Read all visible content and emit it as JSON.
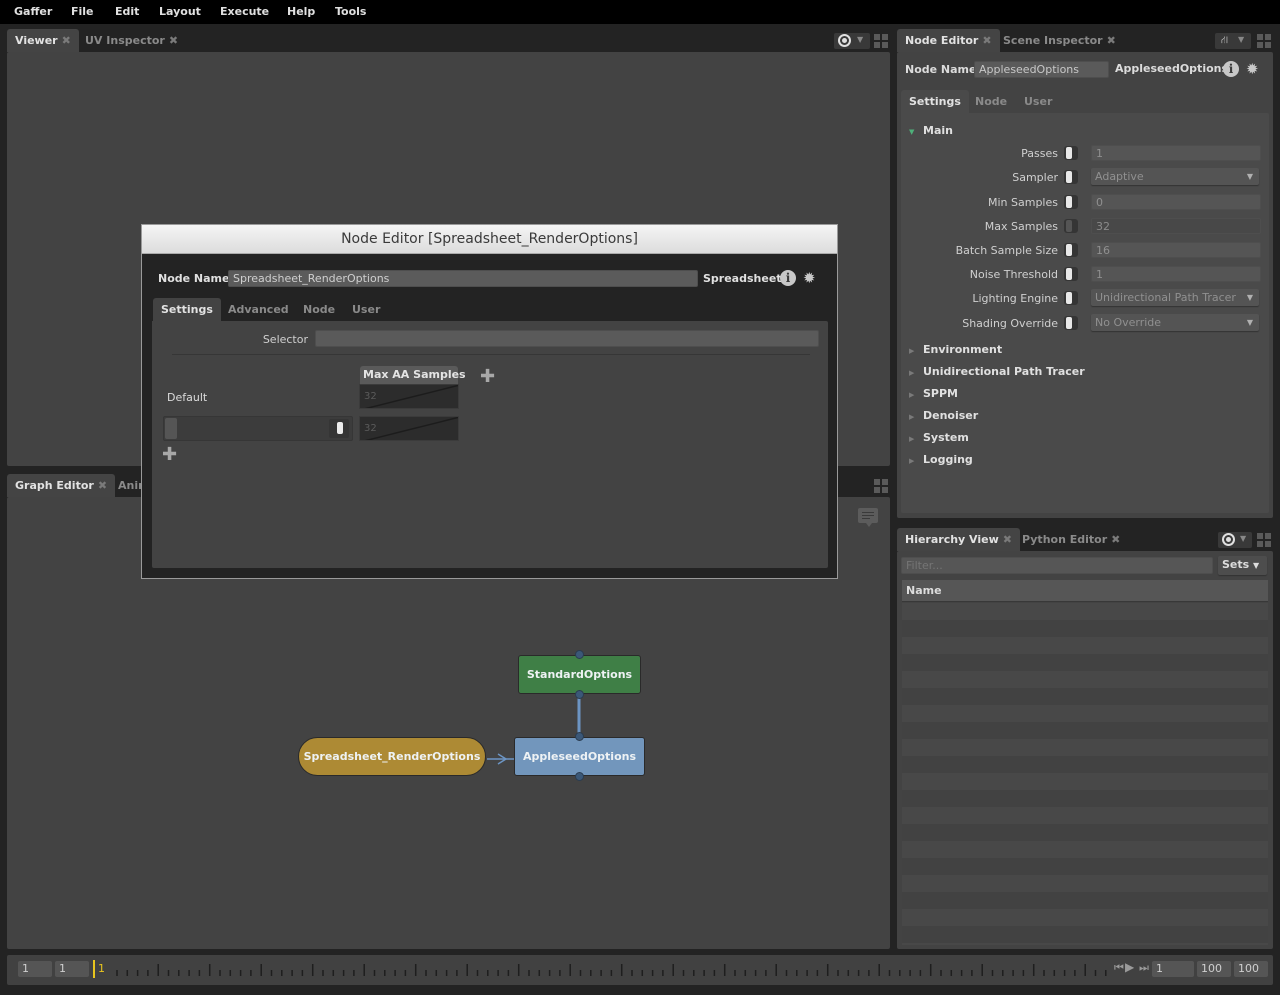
{
  "menu": [
    "Gaffer",
    "File",
    "Edit",
    "Layout",
    "Execute",
    "Help",
    "Tools"
  ],
  "viewer_panel": {
    "tabs": [
      {
        "label": "Viewer",
        "active": true
      },
      {
        "label": "UV Inspector",
        "active": false
      }
    ],
    "close_glyph": "✖"
  },
  "graph_panel": {
    "tabs": [
      {
        "label": "Graph Editor",
        "active": true
      },
      {
        "label": "Anim",
        "active": false
      }
    ],
    "nodes": [
      {
        "name": "StandardOptions",
        "color": "#3f7f46",
        "shape": "rect"
      },
      {
        "name": "AppleseedOptions",
        "color": "#7296bc",
        "shape": "rect"
      },
      {
        "name": "Spreadsheet_RenderOptions",
        "color": "#ad8a34",
        "shape": "pill"
      }
    ],
    "connections": [
      {
        "from": "StandardOptions",
        "to": "AppleseedOptions"
      },
      {
        "from": "Spreadsheet_RenderOptions",
        "to": "AppleseedOptions"
      }
    ]
  },
  "node_editor_panel": {
    "tabs": [
      {
        "label": "Node Editor",
        "active": true
      },
      {
        "label": "Scene Inspector",
        "active": false
      }
    ],
    "node_name_label": "Node Name",
    "node_name_value": "AppleseedOptions",
    "node_type": "AppleseedOptions",
    "sub_tabs": [
      {
        "label": "Settings",
        "active": true
      },
      {
        "label": "Node",
        "active": false
      },
      {
        "label": "User",
        "active": false
      }
    ],
    "main_section": "Main",
    "fields": [
      {
        "label": "Passes",
        "value": "1",
        "type": "number",
        "enabled": true
      },
      {
        "label": "Sampler",
        "value": "Adaptive",
        "type": "dropdown",
        "enabled": true
      },
      {
        "label": "Min Samples",
        "value": "0",
        "type": "number",
        "enabled": true
      },
      {
        "label": "Max Samples",
        "value": "32",
        "type": "number",
        "enabled": false
      },
      {
        "label": "Batch Sample Size",
        "value": "16",
        "type": "number",
        "enabled": true
      },
      {
        "label": "Noise Threshold",
        "value": "1",
        "type": "number",
        "enabled": true
      },
      {
        "label": "Lighting Engine",
        "value": "Unidirectional Path Tracer",
        "type": "dropdown",
        "enabled": true
      },
      {
        "label": "Shading Override",
        "value": "No Override",
        "type": "dropdown",
        "enabled": true
      }
    ],
    "collapsed_sections": [
      "Environment",
      "Unidirectional Path Tracer",
      "SPPM",
      "Denoiser",
      "System",
      "Logging"
    ]
  },
  "hierarchy_panel": {
    "tabs": [
      {
        "label": "Hierarchy View",
        "active": true
      },
      {
        "label": "Python Editor",
        "active": false
      }
    ],
    "filter_placeholder": "Filter...",
    "sets_label": "Sets",
    "column_header": "Name"
  },
  "dialog": {
    "title": "Node Editor [Spreadsheet_RenderOptions]",
    "node_name_label": "Node Name",
    "node_name_value": "Spreadsheet_RenderOptions",
    "node_type": "Spreadsheet",
    "tabs": [
      {
        "label": "Settings",
        "active": true
      },
      {
        "label": "Advanced",
        "active": false
      },
      {
        "label": "Node",
        "active": false
      },
      {
        "label": "User",
        "active": false
      }
    ],
    "selector_label": "Selector",
    "selector_value": "",
    "column_header": "Max AA Samples",
    "rows": [
      {
        "name": "Default",
        "value": "32"
      },
      {
        "name": "",
        "value": "32",
        "enabled": true
      }
    ]
  },
  "timeline": {
    "start_field": "1",
    "end_field": "1",
    "current_frame": "1",
    "frame_field": "1",
    "range_start": "100",
    "range_end": "100",
    "accent": "#e8c51e"
  }
}
